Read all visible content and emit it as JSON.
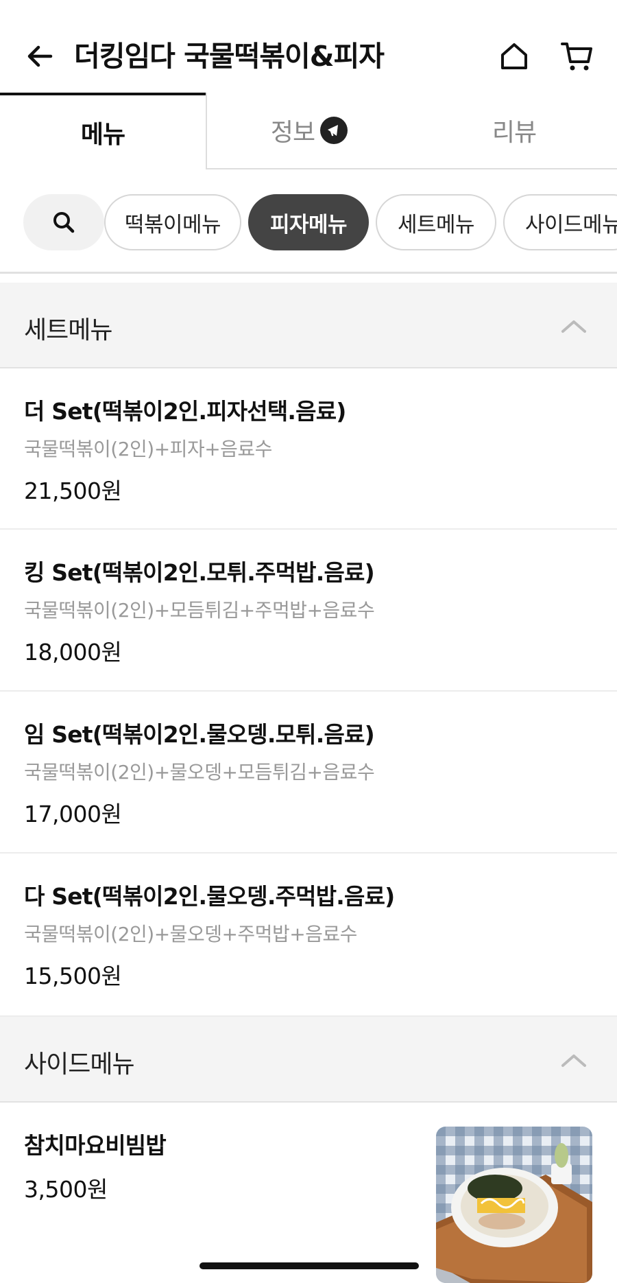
{
  "header": {
    "title": "더킹임다 국물떡볶이&피자",
    "back_icon": "arrow-left-icon",
    "home_icon": "home-icon",
    "cart_icon": "cart-icon"
  },
  "tabs": [
    {
      "label": "메뉴",
      "active": true
    },
    {
      "label": "정보",
      "active": false,
      "badge_icon": "megaphone-icon"
    },
    {
      "label": "리뷰",
      "active": false
    }
  ],
  "category_chips": {
    "search_icon": "search-icon",
    "items": [
      {
        "label": "떡볶이메뉴",
        "active": false
      },
      {
        "label": "피자메뉴",
        "active": true
      },
      {
        "label": "세트메뉴",
        "active": false
      },
      {
        "label": "사이드메뉴",
        "active": false
      }
    ]
  },
  "sections": [
    {
      "title": "세트메뉴",
      "items": [
        {
          "name": "더 Set(떡볶이2인.피자선택.음료)",
          "description": "국물떡볶이(2인)+피자+음료수",
          "price": "21,500원"
        },
        {
          "name": "킹 Set(떡볶이2인.모튀.주먹밥.음료)",
          "description": "국물떡볶이(2인)+모듬튀김+주먹밥+음료수",
          "price": "18,000원"
        },
        {
          "name": "임 Set(떡볶이2인.물오뎅.모튀.음료)",
          "description": "국물떡볶이(2인)+물오뎅+모듬튀김+음료수",
          "price": "17,000원"
        },
        {
          "name": "다 Set(떡볶이2인.물오뎅.주먹밥.음료)",
          "description": "국물떡볶이(2인)+물오뎅+주먹밥+음료수",
          "price": "15,500원"
        }
      ]
    },
    {
      "title": "사이드메뉴",
      "items": [
        {
          "name": "참치마요비빔밥",
          "price": "3,500원",
          "image": "tuna-mayo-bibimbap-photo"
        }
      ]
    }
  ],
  "colors": {
    "active_chip_bg": "#444444",
    "section_bg": "#f4f4f4",
    "muted_text": "#999999"
  }
}
